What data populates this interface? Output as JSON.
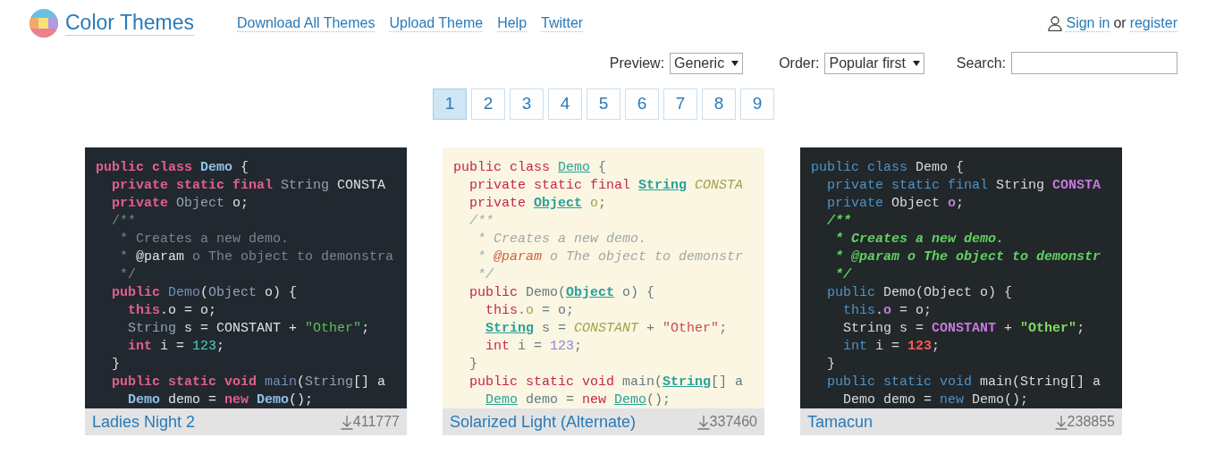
{
  "site": {
    "title": "Color Themes"
  },
  "nav": [
    {
      "label": "Download All Themes"
    },
    {
      "label": "Upload Theme"
    },
    {
      "label": "Help"
    },
    {
      "label": "Twitter"
    }
  ],
  "account": {
    "sign_in": "Sign in",
    "separator": "or",
    "register": "register"
  },
  "filters": {
    "preview": {
      "label": "Preview:",
      "value": "Generic"
    },
    "order": {
      "label": "Order:",
      "value": "Popular first"
    },
    "search": {
      "label": "Search:"
    }
  },
  "pages": [
    {
      "label": "1",
      "selected": true
    },
    {
      "label": "2",
      "selected": false
    },
    {
      "label": "3",
      "selected": false
    },
    {
      "label": "4",
      "selected": false
    },
    {
      "label": "5",
      "selected": false
    },
    {
      "label": "6",
      "selected": false
    },
    {
      "label": "7",
      "selected": false
    },
    {
      "label": "8",
      "selected": false
    },
    {
      "label": "9",
      "selected": false
    }
  ],
  "themes": [
    {
      "name": "Ladies Night 2",
      "downloads": "411777",
      "kind": "ladies",
      "code": [
        [
          {
            "kind": "k",
            "text": "public class "
          },
          {
            "kind": "m",
            "text": "Demo"
          },
          {
            "kind": "p",
            "text": " {"
          }
        ],
        [
          {
            "kind": "k",
            "text": "  private static final "
          },
          {
            "kind": "t",
            "text": "String"
          },
          {
            "kind": "x",
            "text": " CONSTA"
          }
        ],
        [
          {
            "kind": "k",
            "text": "  private "
          },
          {
            "kind": "t",
            "text": "Object"
          },
          {
            "kind": "v",
            "text": " o"
          },
          {
            "kind": "p",
            "text": ";"
          }
        ],
        [
          {
            "kind": "c",
            "text": "  /**"
          }
        ],
        [
          {
            "kind": "c",
            "text": "   * Creates a new demo."
          }
        ],
        [
          {
            "kind": "c",
            "text": "   * "
          },
          {
            "kind": "d",
            "text": "@param"
          },
          {
            "kind": "c",
            "text": " o The object to demonstra"
          }
        ],
        [
          {
            "kind": "c",
            "text": "   */"
          }
        ],
        [
          {
            "kind": "k",
            "text": "  public "
          },
          {
            "kind": "f",
            "text": "Demo"
          },
          {
            "kind": "p",
            "text": "("
          },
          {
            "kind": "t",
            "text": "Object"
          },
          {
            "kind": "p",
            "text": " o) {"
          }
        ],
        [
          {
            "kind": "k",
            "text": "    this"
          },
          {
            "kind": "p",
            "text": "."
          },
          {
            "kind": "v",
            "text": "o"
          },
          {
            "kind": "p",
            "text": " = o;"
          }
        ],
        [
          {
            "kind": "t",
            "text": "    String"
          },
          {
            "kind": "p",
            "text": " s = "
          },
          {
            "kind": "x",
            "text": "CONSTANT"
          },
          {
            "kind": "p",
            "text": " + "
          },
          {
            "kind": "s",
            "text": "\"Other\""
          },
          {
            "kind": "p",
            "text": ";"
          }
        ],
        [
          {
            "kind": "k",
            "text": "    int"
          },
          {
            "kind": "p",
            "text": " i = "
          },
          {
            "kind": "n",
            "text": "123"
          },
          {
            "kind": "p",
            "text": ";"
          }
        ],
        [
          {
            "kind": "p",
            "text": "  }"
          }
        ],
        [
          {
            "kind": "k",
            "text": "  public static void "
          },
          {
            "kind": "f",
            "text": "main"
          },
          {
            "kind": "p",
            "text": "("
          },
          {
            "kind": "t",
            "text": "String"
          },
          {
            "kind": "p",
            "text": "[] a"
          }
        ],
        [
          {
            "kind": "m",
            "text": "    Demo"
          },
          {
            "kind": "p",
            "text": " demo = "
          },
          {
            "kind": "k",
            "text": "new "
          },
          {
            "kind": "m",
            "text": "Demo"
          },
          {
            "kind": "p",
            "text": "();"
          }
        ]
      ]
    },
    {
      "name": "Solarized Light (Alternate)",
      "downloads": "337460",
      "kind": "solar",
      "code": [
        [
          {
            "kind": "k",
            "text": "public class "
          },
          {
            "kind": "m",
            "text": "Demo"
          },
          {
            "kind": "p",
            "text": " {"
          }
        ],
        [
          {
            "kind": "k",
            "text": "  private static final "
          },
          {
            "kind": "t",
            "text": "String"
          },
          {
            "kind": "x",
            "text": " CONSTA"
          }
        ],
        [
          {
            "kind": "k",
            "text": "  private "
          },
          {
            "kind": "t",
            "text": "Object"
          },
          {
            "kind": "v",
            "text": " o"
          },
          {
            "kind": "p",
            "text": ";"
          }
        ],
        [
          {
            "kind": "c",
            "text": "  /**"
          }
        ],
        [
          {
            "kind": "c",
            "text": "   * Creates a new demo."
          }
        ],
        [
          {
            "kind": "c",
            "text": "   * "
          },
          {
            "kind": "d",
            "text": "@param"
          },
          {
            "kind": "c",
            "text": " o The object to demonstr"
          }
        ],
        [
          {
            "kind": "c",
            "text": "   */"
          }
        ],
        [
          {
            "kind": "k",
            "text": "  public "
          },
          {
            "kind": "f",
            "text": "Demo"
          },
          {
            "kind": "p",
            "text": "("
          },
          {
            "kind": "t",
            "text": "Object"
          },
          {
            "kind": "p",
            "text": " o) {"
          }
        ],
        [
          {
            "kind": "k",
            "text": "    this"
          },
          {
            "kind": "p",
            "text": "."
          },
          {
            "kind": "v",
            "text": "o"
          },
          {
            "kind": "p",
            "text": " = o;"
          }
        ],
        [
          {
            "kind": "t",
            "text": "    String"
          },
          {
            "kind": "p",
            "text": " s = "
          },
          {
            "kind": "x",
            "text": "CONSTANT"
          },
          {
            "kind": "p",
            "text": " + "
          },
          {
            "kind": "s",
            "text": "\"Other\""
          },
          {
            "kind": "p",
            "text": ";"
          }
        ],
        [
          {
            "kind": "k",
            "text": "    int"
          },
          {
            "kind": "p",
            "text": " i = "
          },
          {
            "kind": "n",
            "text": "123"
          },
          {
            "kind": "p",
            "text": ";"
          }
        ],
        [
          {
            "kind": "p",
            "text": "  }"
          }
        ],
        [
          {
            "kind": "k",
            "text": "  public static void "
          },
          {
            "kind": "f",
            "text": "main"
          },
          {
            "kind": "p",
            "text": "("
          },
          {
            "kind": "t",
            "text": "String"
          },
          {
            "kind": "p",
            "text": "[] a"
          }
        ],
        [
          {
            "kind": "m",
            "text": "    Demo"
          },
          {
            "kind": "p",
            "text": " demo = "
          },
          {
            "kind": "k",
            "text": "new "
          },
          {
            "kind": "m",
            "text": "Demo"
          },
          {
            "kind": "p",
            "text": "();"
          }
        ]
      ]
    },
    {
      "name": "Tamacun",
      "downloads": "238855",
      "kind": "tamacun",
      "code": [
        [
          {
            "kind": "k",
            "text": "public class "
          },
          {
            "kind": "m",
            "text": "Demo"
          },
          {
            "kind": "p",
            "text": " {"
          }
        ],
        [
          {
            "kind": "k",
            "text": "  private static final "
          },
          {
            "kind": "t",
            "text": "String"
          },
          {
            "kind": "x",
            "text": " CONSTA"
          }
        ],
        [
          {
            "kind": "k",
            "text": "  private "
          },
          {
            "kind": "t",
            "text": "Object"
          },
          {
            "kind": "v",
            "text": " o"
          },
          {
            "kind": "p",
            "text": ";"
          }
        ],
        [
          {
            "kind": "c",
            "text": "  /**"
          }
        ],
        [
          {
            "kind": "c",
            "text": "   * Creates a new demo."
          }
        ],
        [
          {
            "kind": "c",
            "text": "   * "
          },
          {
            "kind": "d",
            "text": "@param"
          },
          {
            "kind": "c",
            "text": " o The object to demonstr"
          }
        ],
        [
          {
            "kind": "c",
            "text": "   */"
          }
        ],
        [
          {
            "kind": "k",
            "text": "  public "
          },
          {
            "kind": "f",
            "text": "Demo"
          },
          {
            "kind": "p",
            "text": "("
          },
          {
            "kind": "t",
            "text": "Object"
          },
          {
            "kind": "p",
            "text": " o) {"
          }
        ],
        [
          {
            "kind": "k",
            "text": "    this"
          },
          {
            "kind": "p",
            "text": "."
          },
          {
            "kind": "v",
            "text": "o"
          },
          {
            "kind": "p",
            "text": " = o;"
          }
        ],
        [
          {
            "kind": "t",
            "text": "    String"
          },
          {
            "kind": "p",
            "text": " s = "
          },
          {
            "kind": "x",
            "text": "CONSTANT"
          },
          {
            "kind": "p",
            "text": " + "
          },
          {
            "kind": "s",
            "text": "\"Other\""
          },
          {
            "kind": "p",
            "text": ";"
          }
        ],
        [
          {
            "kind": "k",
            "text": "    int"
          },
          {
            "kind": "p",
            "text": " i = "
          },
          {
            "kind": "n",
            "text": "123"
          },
          {
            "kind": "p",
            "text": ";"
          }
        ],
        [
          {
            "kind": "p",
            "text": "  }"
          }
        ],
        [
          {
            "kind": "k",
            "text": "  public static void "
          },
          {
            "kind": "f",
            "text": "main"
          },
          {
            "kind": "p",
            "text": "("
          },
          {
            "kind": "t",
            "text": "String"
          },
          {
            "kind": "p",
            "text": "[] a"
          }
        ],
        [
          {
            "kind": "m",
            "text": "    Demo"
          },
          {
            "kind": "p",
            "text": " demo = "
          },
          {
            "kind": "k",
            "text": "new "
          },
          {
            "kind": "m",
            "text": "Demo"
          },
          {
            "kind": "p",
            "text": "();"
          }
        ]
      ]
    }
  ]
}
